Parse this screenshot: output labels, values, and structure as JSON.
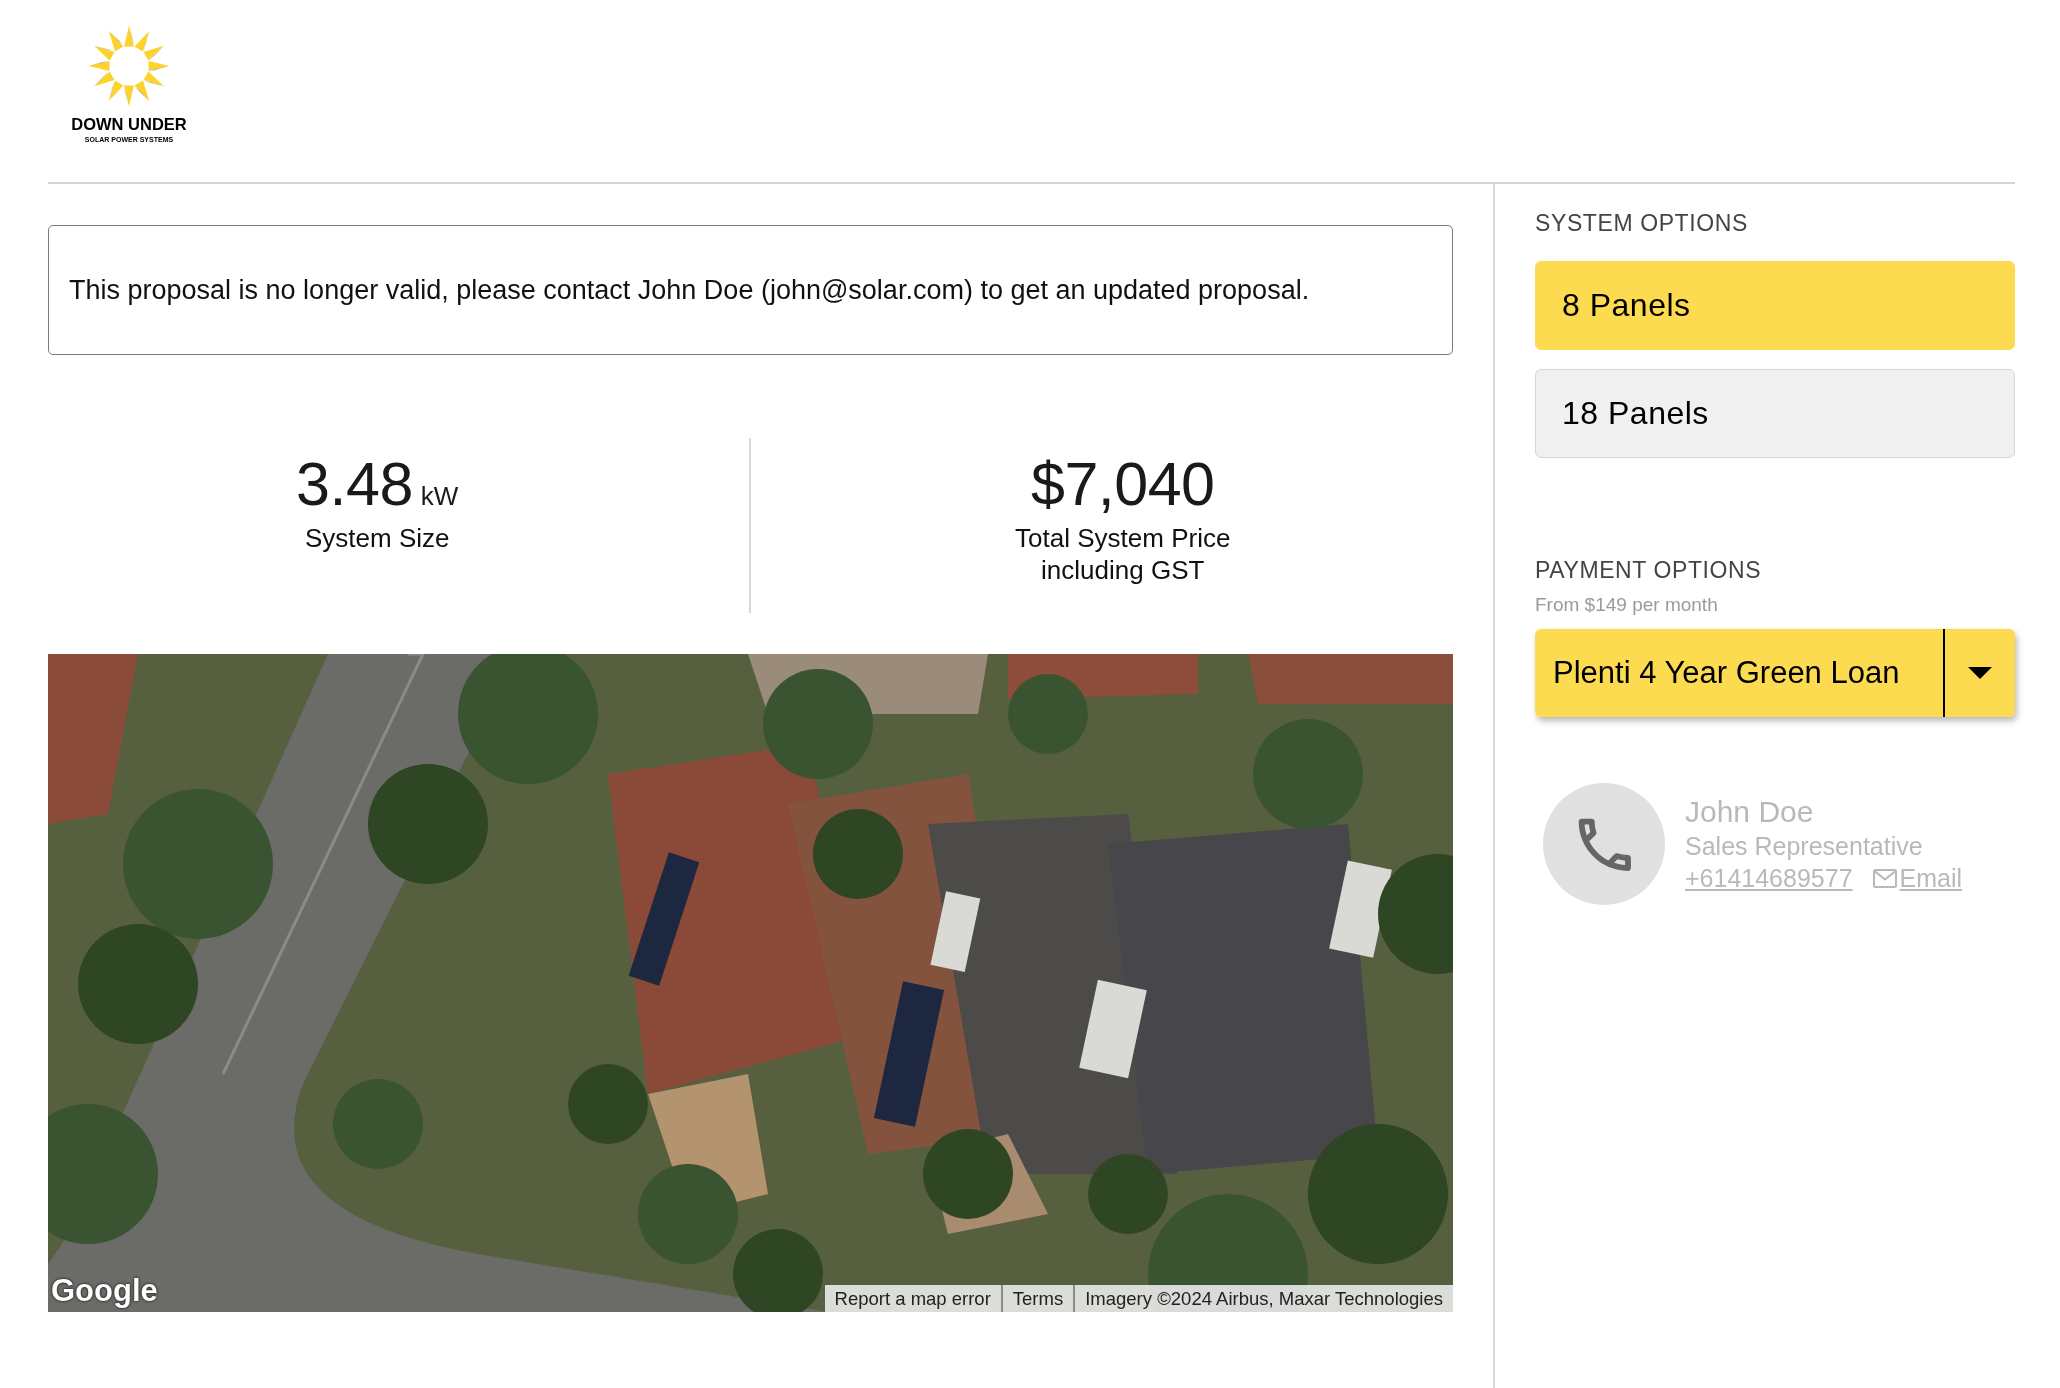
{
  "logo": {
    "name": "DOWN UNDER",
    "tagline": "SOLAR POWER SYSTEMS"
  },
  "alert": {
    "message": "This proposal is no longer valid, please contact John Doe (john@solar.com) to get an updated proposal."
  },
  "stats": [
    {
      "value": "3.48",
      "unit": "kW",
      "label": "System Size"
    },
    {
      "value": "$7,040",
      "label": "Total System Price including GST"
    }
  ],
  "map": {
    "logo": "Google",
    "attribution": [
      "Report a map error",
      "Terms",
      "Imagery ©2024 Airbus, Maxar Technologies"
    ]
  },
  "system_options": {
    "title": "SYSTEM OPTIONS",
    "options": [
      {
        "label": "8 Panels",
        "selected": true
      },
      {
        "label": "18 Panels",
        "selected": false
      }
    ]
  },
  "payment_options": {
    "title": "PAYMENT OPTIONS",
    "subtitle": "From $149 per month",
    "plan": "Plenti 4 Year Green Loan"
  },
  "contact": {
    "name": "John Doe",
    "role": "Sales Representative",
    "phone": "+61414689577",
    "email_label": "Email"
  }
}
